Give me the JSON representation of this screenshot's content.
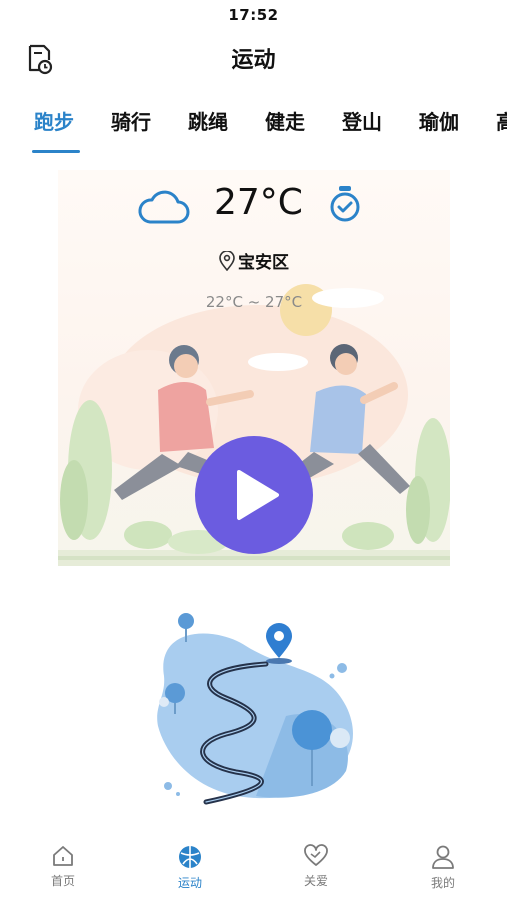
{
  "status_bar": {
    "time": "17:52"
  },
  "header": {
    "title": "运动",
    "history_icon": "record-history-icon"
  },
  "tabs": [
    {
      "label": "跑步",
      "active": true
    },
    {
      "label": "骑行",
      "active": false
    },
    {
      "label": "跳绳",
      "active": false
    },
    {
      "label": "健走",
      "active": false
    },
    {
      "label": "登山",
      "active": false
    },
    {
      "label": "瑜伽",
      "active": false
    },
    {
      "label": "高",
      "active": false
    }
  ],
  "weather": {
    "icon": "cloud-icon",
    "temperature": "27°C",
    "location": "宝安区",
    "range": "22°C ~ 27°C"
  },
  "start_button": {
    "icon": "play-icon",
    "color": "#6b5ce0"
  },
  "bottom_nav": [
    {
      "label": "首页",
      "icon": "home-icon",
      "active": false
    },
    {
      "label": "运动",
      "icon": "sport-ball-icon",
      "active": true
    },
    {
      "label": "关爱",
      "icon": "heart-care-icon",
      "active": false
    },
    {
      "label": "我的",
      "icon": "profile-icon",
      "active": false
    }
  ],
  "colors": {
    "accent": "#2b83c9",
    "play": "#6b5ce0",
    "inactive": "#7a7a7a"
  }
}
